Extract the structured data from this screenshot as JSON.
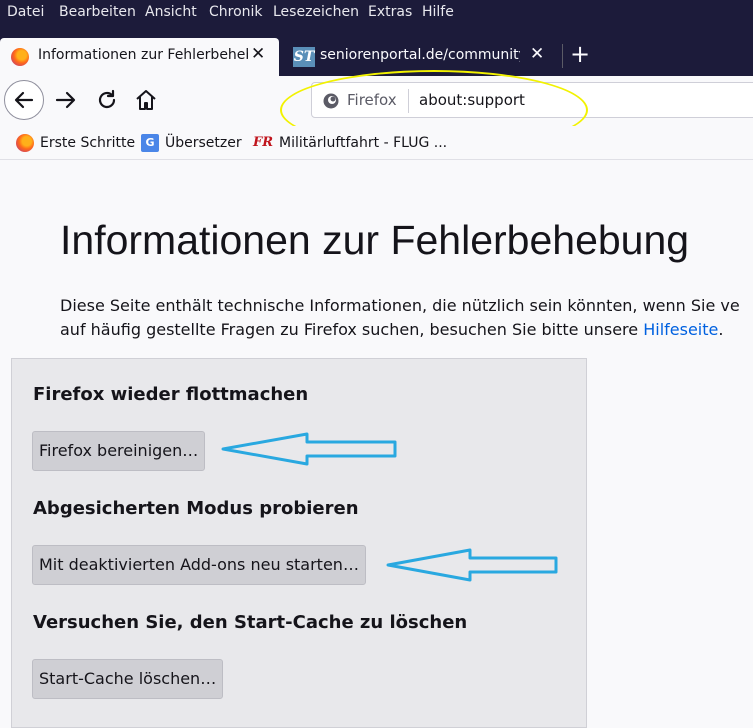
{
  "menu": [
    "Datei",
    "Bearbeiten",
    "Ansicht",
    "Chronik",
    "Lesezeichen",
    "Extras",
    "Hilfe"
  ],
  "tabs": [
    {
      "title": "Informationen zur Fehlerbehebung",
      "icon": "firefox-icon"
    },
    {
      "title": "seniorenportal.de/community/t",
      "icon": "seniorenportal-icon",
      "favicon_text": "ST"
    }
  ],
  "urlbar": {
    "identity": "Firefox",
    "url": "about:support"
  },
  "bookmarks": [
    {
      "label": "Erste Schritte",
      "icon": "firefox-icon"
    },
    {
      "label": "Übersetzer",
      "icon": "translate-icon"
    },
    {
      "label": "Militärluftfahrt - FLUG ...",
      "icon": "flug-icon",
      "favicon_text": "FR"
    }
  ],
  "page": {
    "title": "Informationen zur Fehlerbehebung",
    "intro_line1": "Diese Seite enthält technische Informationen, die nützlich sein könnten, wenn Sie ve",
    "intro_line2_before": "auf häufig gestellte Fragen zu Firefox suchen, besuchen Sie bitte unsere ",
    "intro_link": "Hilfeseite",
    "intro_line2_after": "."
  },
  "sections": [
    {
      "heading": "Firefox wieder flottmachen",
      "button": "Firefox bereinigen…"
    },
    {
      "heading": "Abgesicherten Modus probieren",
      "button": "Mit deaktivierten Add-ons neu starten…"
    },
    {
      "heading": "Versuchen Sie, den Start-Cache zu löschen",
      "button": "Start-Cache löschen…"
    }
  ],
  "colors": {
    "chrome_dark": "#1c1b3a",
    "link": "#0061e0",
    "annotation_arrow": "#29a8e0",
    "annotation_ellipse": "#f2f200"
  }
}
